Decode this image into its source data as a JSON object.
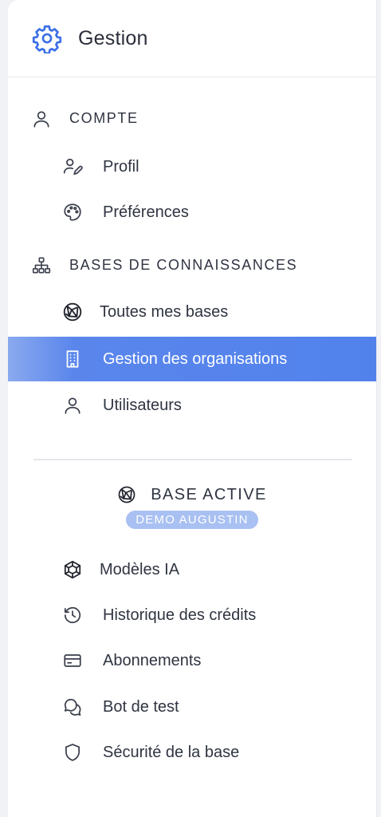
{
  "header": {
    "title": "Gestion",
    "icon": "gear-icon"
  },
  "colors": {
    "accent": "#5182ec",
    "badge": "#a9c0f2",
    "icon_blue": "#3b6fe6"
  },
  "sections": {
    "compte": {
      "label": "COMPTE",
      "icon": "user-icon",
      "items": [
        {
          "label": "Profil",
          "icon": "user-edit-icon"
        },
        {
          "label": "Préférences",
          "icon": "palette-icon"
        }
      ]
    },
    "bases": {
      "label": "BASES DE CONNAISSANCES",
      "icon": "sitemap-icon",
      "items": [
        {
          "label": "Toutes mes bases",
          "icon": "network-ball-icon"
        },
        {
          "label": "Gestion des organisations",
          "icon": "building-icon",
          "active": true
        },
        {
          "label": "Utilisateurs",
          "icon": "user-icon"
        }
      ]
    }
  },
  "active_base": {
    "label": "BASE ACTIVE",
    "icon": "network-ball-icon",
    "name": "DEMO AUGUSTIN",
    "items": [
      {
        "label": "Modèles IA",
        "icon": "cube-network-icon"
      },
      {
        "label": "Historique des crédits",
        "icon": "history-icon"
      },
      {
        "label": "Abonnements",
        "icon": "credit-card-icon"
      },
      {
        "label": "Bot de test",
        "icon": "chat-bubbles-icon"
      },
      {
        "label": "Sécurité de la base",
        "icon": "shield-icon"
      }
    ]
  }
}
